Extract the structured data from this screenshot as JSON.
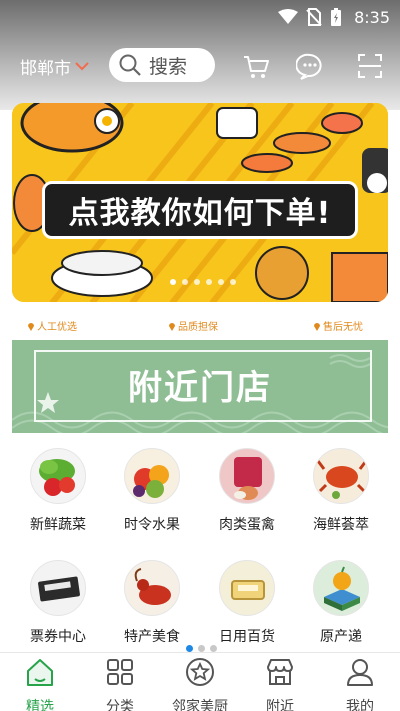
{
  "status": {
    "time": "8:35"
  },
  "header": {
    "city": "邯郸市",
    "search_placeholder": "搜索"
  },
  "banner": {
    "title": "点我教你如何下单!"
  },
  "guarantees": [
    "人工优选",
    "品质担保",
    "售后无忧"
  ],
  "store_banner": {
    "title": "附近门店"
  },
  "categories": [
    {
      "label": "新鲜蔬菜",
      "icon": "vegetables-icon"
    },
    {
      "label": "时令水果",
      "icon": "fruit-icon"
    },
    {
      "label": "肉类蛋禽",
      "icon": "meat-icon"
    },
    {
      "label": "海鲜荟萃",
      "icon": "seafood-icon"
    },
    {
      "label": "票券中心",
      "icon": "ticket-icon"
    },
    {
      "label": "特产美食",
      "icon": "specialty-food-icon"
    },
    {
      "label": "日用百货",
      "icon": "daily-goods-icon"
    },
    {
      "label": "原产递",
      "icon": "origin-delivery-icon"
    }
  ],
  "bottom_nav": [
    {
      "label": "精选",
      "active": true
    },
    {
      "label": "分类",
      "active": false
    },
    {
      "label": "邻家美厨",
      "active": false
    },
    {
      "label": "附近",
      "active": false
    },
    {
      "label": "我的",
      "active": false
    }
  ],
  "colors": {
    "accent_green": "#27a34a",
    "guarantee_orange": "#e08a1e",
    "store_green": "#8fbe95"
  }
}
